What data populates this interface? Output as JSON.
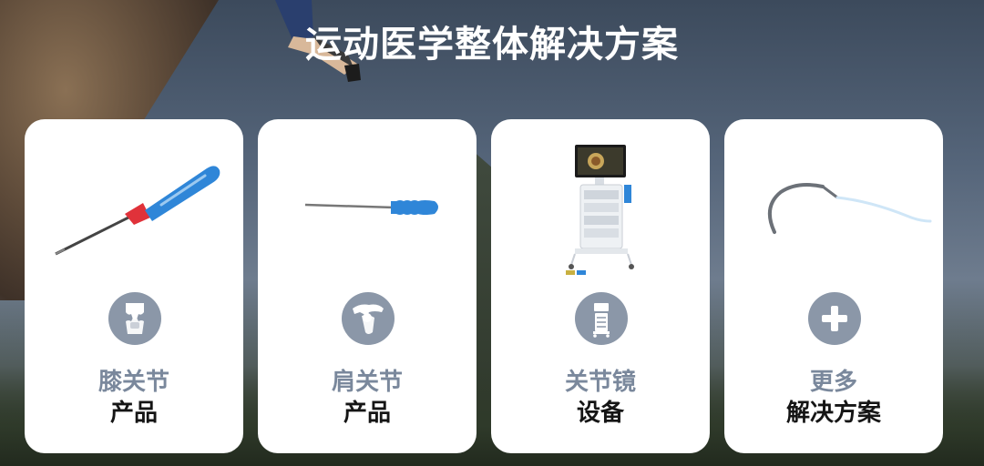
{
  "page": {
    "title": "运动医学整体解决方案"
  },
  "cards": [
    {
      "line1": "膝关节",
      "line2": "产品",
      "icon": "knee-joint-icon",
      "product": "bone-probe-instrument"
    },
    {
      "line1": "肩关节",
      "line2": "产品",
      "icon": "shoulder-joint-icon",
      "product": "shoulder-awl-instrument"
    },
    {
      "line1": "关节镜",
      "line2": "设备",
      "icon": "arthroscope-cart-icon",
      "product": "arthroscopy-tower"
    },
    {
      "line1": "更多",
      "line2": "解决方案",
      "icon": "plus-icon",
      "product": "suture-needle"
    }
  ],
  "colors": {
    "icon_circle": "#8b97a8",
    "label_primary": "#7a889c",
    "label_secondary": "#151515",
    "card": "#ffffff",
    "instrument_blue": "#2f86d8",
    "instrument_red": "#e0323a"
  }
}
